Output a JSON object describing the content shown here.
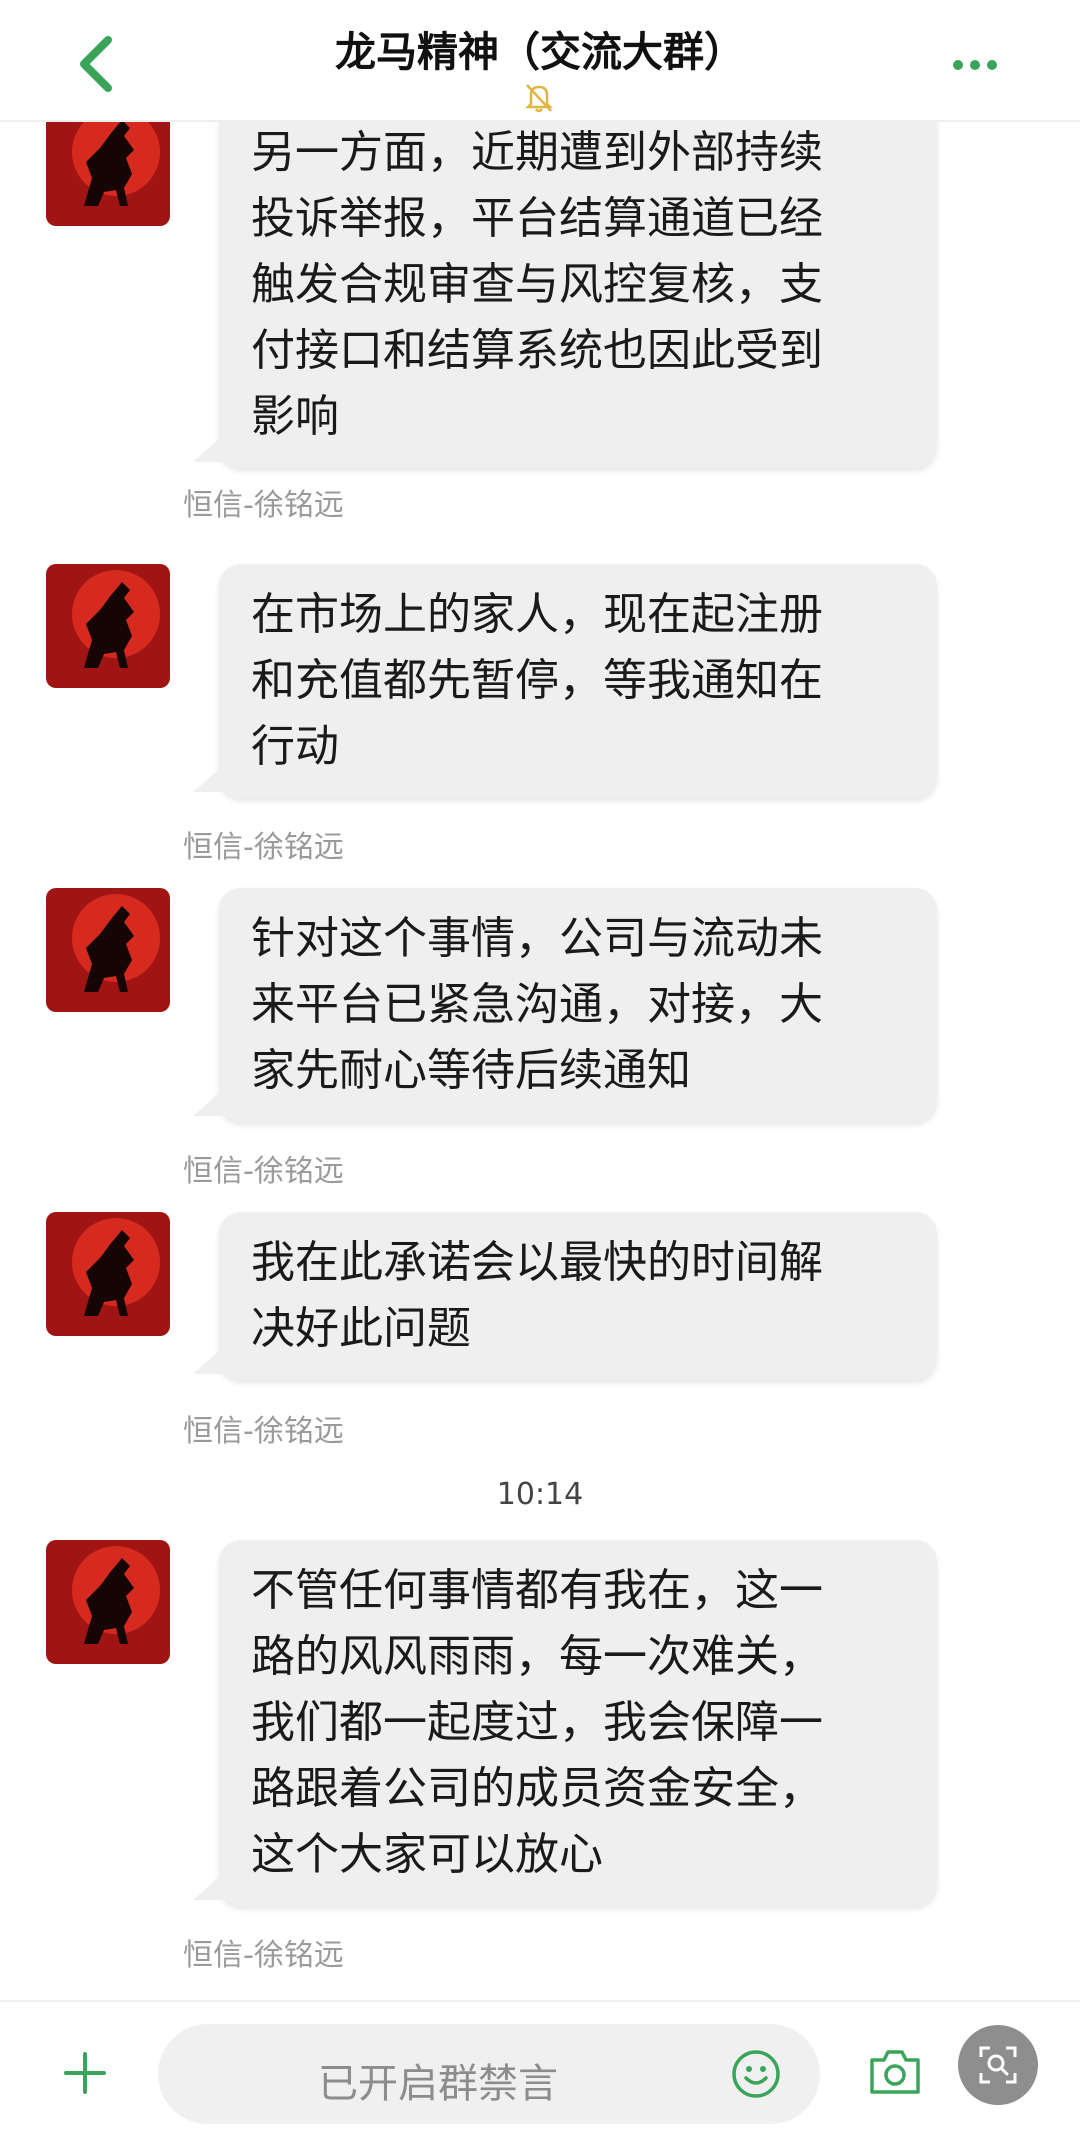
{
  "header": {
    "title": "龙马精神（交流大群）",
    "back_icon": "chevron-left-icon",
    "mute_icon": "bell-off-icon",
    "more_icon": "more-horizontal-icon"
  },
  "messages": [
    {
      "lines": [
        "另一方面，近期遭到外部持续",
        "投诉举报，平台结算通道已经",
        "触发合规审查与风控复核，支",
        "付接口和结算系统也因此受到",
        "影响"
      ],
      "sender": "恒信-徐铭远"
    },
    {
      "lines": [
        "在市场上的家人，现在起注册",
        "和充值都先暂停，等我通知在",
        "行动"
      ],
      "sender": "恒信-徐铭远"
    },
    {
      "lines": [
        "针对这个事情，公司与流动未",
        "来平台已紧急沟通，对接，大",
        "家先耐心等待后续通知"
      ],
      "sender": "恒信-徐铭远"
    },
    {
      "lines": [
        "我在此承诺会以最快的时间解",
        "决好此问题"
      ],
      "sender": "恒信-徐铭远"
    },
    {
      "lines": [
        "不管任何事情都有我在，这一",
        "路的风风雨雨，每一次难关，",
        "我们都一起度过，我会保障一",
        "路跟着公司的成员资金安全，",
        "这个大家可以放心"
      ],
      "sender": "恒信-徐铭远"
    }
  ],
  "time_separator": "10:14",
  "input_bar": {
    "mute_placeholder": "已开启群禁言",
    "plus_icon": "plus-icon",
    "emoji_icon": "smiley-icon",
    "camera_icon": "camera-icon",
    "scan_icon": "search-scan-icon"
  },
  "colors": {
    "accent_green": "#3aa55a",
    "bubble_bg": "#efefef",
    "sender_gray": "#9a9a9a"
  }
}
